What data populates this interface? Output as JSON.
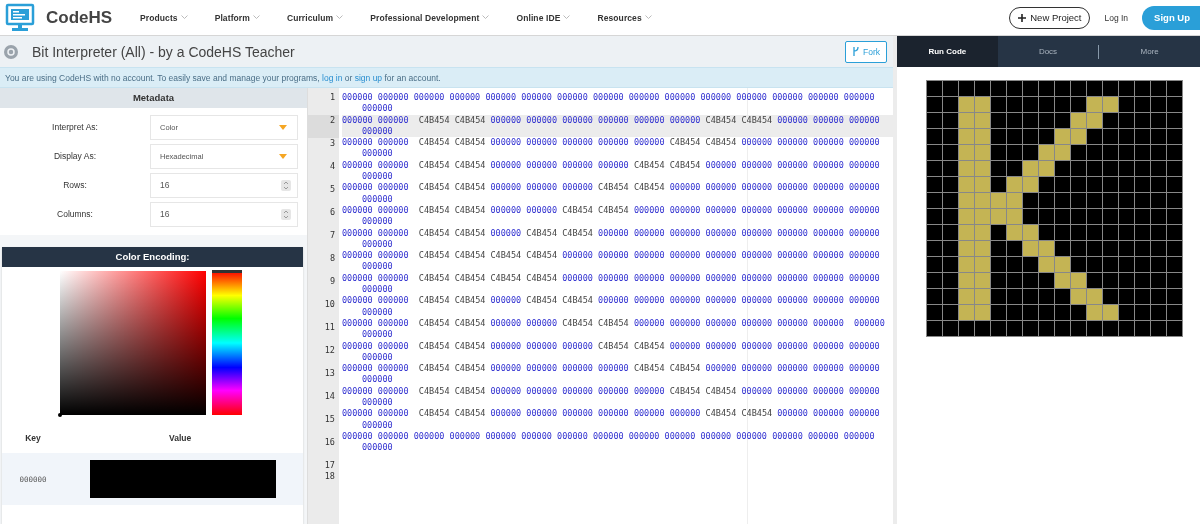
{
  "header": {
    "brand": "CodeHS",
    "nav": [
      "Products",
      "Platform",
      "Curriculum",
      "Professional Development",
      "Online IDE",
      "Resources"
    ],
    "new_project": "New Project",
    "log_in": "Log In",
    "sign_up": "Sign Up"
  },
  "program": {
    "title": "Bit Interpreter (All) - by a CodeHS Teacher",
    "fork": "Fork"
  },
  "notice": {
    "before": "You are using CodeHS with no account. To easily save and manage your programs, ",
    "login_link": "log in",
    "middle": " or ",
    "signup_link": "sign up",
    "after": " for an account."
  },
  "metadata": {
    "title": "Metadata",
    "fields": [
      {
        "label": "Interpret As:",
        "kind": "select",
        "value": "Color"
      },
      {
        "label": "Display As:",
        "kind": "select",
        "value": "Hexadecimal"
      },
      {
        "label": "Rows:",
        "kind": "number",
        "value": "16"
      },
      {
        "label": "Columns:",
        "kind": "number",
        "value": "16"
      }
    ]
  },
  "color_encoding": {
    "title": "Color Encoding:",
    "hue_slider": {
      "level": 0
    },
    "key_header": "Key",
    "value_header": "Value",
    "entries": [
      {
        "key": "000000"
      }
    ]
  },
  "editor": {
    "lines": [
      {
        "number": "1",
        "selected": false,
        "text": "000000 000000 000000 000000 000000 000000 000000 000000 000000 000000 000000 000000 000000 000000 000000 000000"
      },
      {
        "number": "2",
        "selected": true,
        "text": "000000 000000  C4B454 C4B454 000000 000000 000000 000000 000000 000000 C4B454 C4B454 000000 000000 000000 000000"
      },
      {
        "number": "3",
        "selected": false,
        "text": "000000 000000  C4B454 C4B454 000000 000000 000000 000000 000000 C4B454 C4B454 000000 000000 000000 000000 000000"
      },
      {
        "number": "4",
        "selected": false,
        "text": "000000 000000  C4B454 C4B454 000000 000000 000000 000000 C4B454 C4B454 000000 000000 000000 000000 000000 000000"
      },
      {
        "number": "5",
        "selected": false,
        "text": "000000 000000  C4B454 C4B454 000000 000000 000000 C4B454 C4B454 000000 000000 000000 000000 000000 000000 000000"
      },
      {
        "number": "6",
        "selected": false,
        "text": "000000 000000  C4B454 C4B454 000000 000000 C4B454 C4B454 000000 000000 000000 000000 000000 000000 000000 000000"
      },
      {
        "number": "7",
        "selected": false,
        "text": "000000 000000  C4B454 C4B454 000000 C4B454 C4B454 000000 000000 000000 000000 000000 000000 000000 000000 000000"
      },
      {
        "number": "8",
        "selected": false,
        "text": "000000 000000  C4B454 C4B454 C4B454 C4B454 000000 000000 000000 000000 000000 000000 000000 000000 000000 000000"
      },
      {
        "number": "9",
        "selected": false,
        "text": "000000 000000  C4B454 C4B454 C4B454 C4B454 000000 000000 000000 000000 000000 000000 000000 000000 000000 000000"
      },
      {
        "number": "10",
        "selected": false,
        "text": "000000 000000  C4B454 C4B454 000000 C4B454 C4B454 000000 000000 000000 000000 000000 000000 000000 000000 000000"
      },
      {
        "number": "11",
        "selected": false,
        "text": "000000 000000  C4B454 C4B454 000000 000000 C4B454 C4B454 000000 000000 000000 000000 000000 000000  000000 000000"
      },
      {
        "number": "12",
        "selected": false,
        "text": "000000 000000  C4B454 C4B454 000000 000000 000000 C4B454 C4B454 000000 000000 000000 000000 000000 000000 000000"
      },
      {
        "number": "13",
        "selected": false,
        "text": "000000 000000  C4B454 C4B454 000000 000000 000000 000000 C4B454 C4B454 000000 000000 000000 000000 000000 000000"
      },
      {
        "number": "14",
        "selected": false,
        "text": "000000 000000  C4B454 C4B454 000000 000000 000000 000000 000000 C4B454 C4B454 000000 000000 000000 000000 000000"
      },
      {
        "number": "15",
        "selected": false,
        "text": "000000 000000  C4B454 C4B454 000000 000000 000000 000000 000000 000000 C4B454 C4B454 000000 000000 000000 000000"
      },
      {
        "number": "16",
        "selected": false,
        "text": "000000 000000 000000 000000 000000 000000 000000 000000 000000 000000 000000 000000 000000 000000 000000 000000"
      },
      {
        "number": "17",
        "selected": false
      },
      {
        "number": "18",
        "selected": false
      }
    ]
  },
  "side_tabs": [
    {
      "label": "Run Code",
      "selected": true
    },
    {
      "label": "Docs",
      "selected": false
    },
    {
      "label": "More",
      "selected": false
    }
  ]
}
